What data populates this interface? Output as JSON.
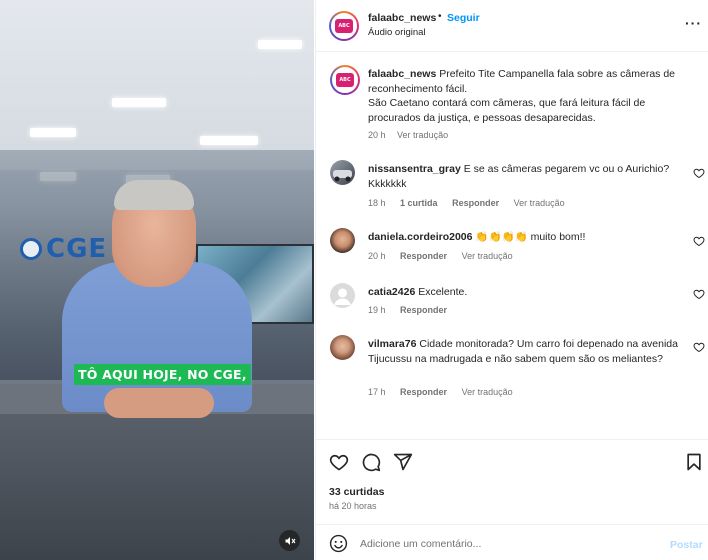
{
  "video": {
    "subtitle": "TÔ AQUI HOJE, NO CGE,",
    "background_logo": "CGE",
    "mute_icon": "speaker-muted-icon"
  },
  "header": {
    "username": "falaabc_news",
    "dot": "•",
    "follow_label": "Seguir",
    "audio": "Áudio original",
    "more_icon": "more-options-icon"
  },
  "caption": {
    "username": "falaabc_news",
    "text": " Prefeito Tite Campanella fala sobre as câmeras de reconhecimento fácil.\nSão Caetano contará com câmeras, que fará leitura fácil de procurados da justiça, e pessoas desaparecidas.",
    "age": "20 h",
    "translate": "Ver tradução"
  },
  "comments": [
    {
      "username": "nissansentra_gray",
      "text": " E se as câmeras pegarem vc ou o Aurichio? Kkkkkkk",
      "age": "18 h",
      "likes": "1 curtida",
      "reply": "Responder",
      "translate": "Ver tradução"
    },
    {
      "username": "daniela.cordeiro2006",
      "text": " 👏👏👏👏 muito bom!!",
      "age": "20 h",
      "reply": "Responder",
      "translate": "Ver tradução"
    },
    {
      "username": "catia2426",
      "text": " Excelente.",
      "age": "19 h",
      "reply": "Responder"
    },
    {
      "username": "vilmara76",
      "text": " Cidade monitorada? Um carro foi depenado na avenida Tijucussu na madrugada e não sabem quem são os meliantes?",
      "age": "17 h",
      "reply": "Responder",
      "translate": "Ver tradução"
    }
  ],
  "actions": {
    "likes": "33 curtidas",
    "time": "há 20 horas",
    "icons": [
      "heart-icon",
      "comment-icon",
      "share-icon",
      "bookmark-icon"
    ]
  },
  "add_comment": {
    "placeholder": "Adicione um comentário...",
    "post_label": "Postar",
    "emoji_icon": "emoji-icon"
  },
  "colors": {
    "accent": "#0095f6",
    "subtitle_bg": "#1db954",
    "muted_text": "#737373",
    "post_disabled": "#b3dbff"
  }
}
